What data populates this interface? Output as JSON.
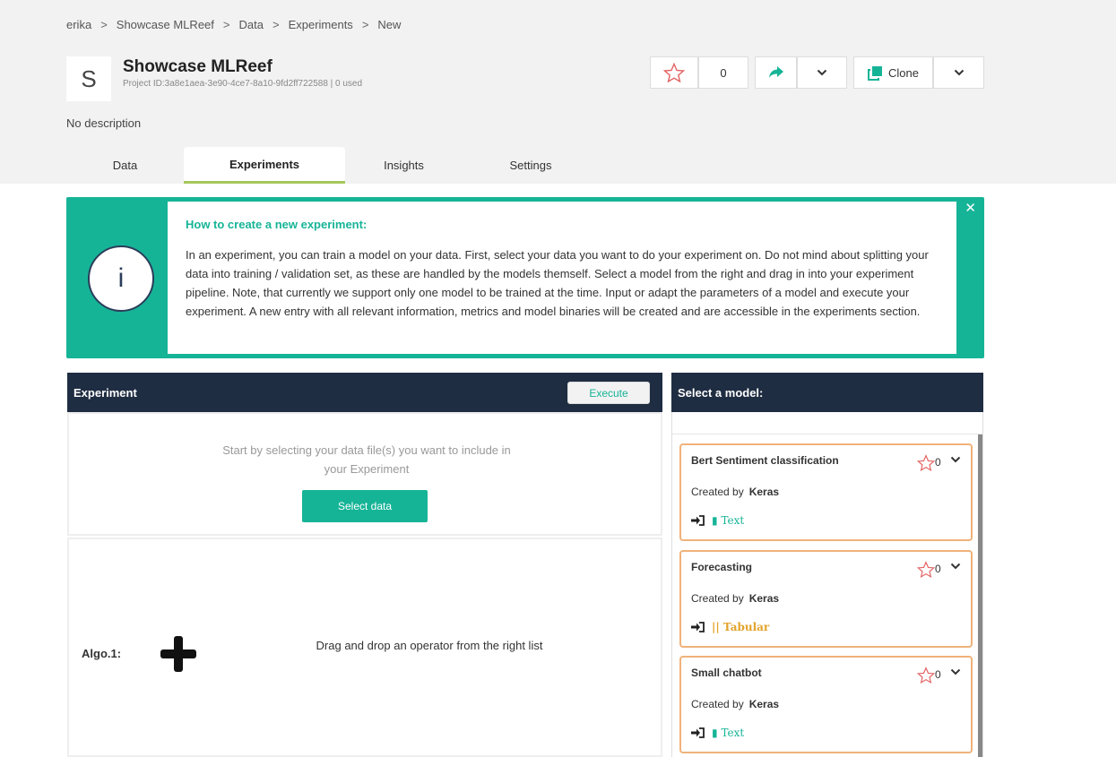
{
  "breadcrumbs": [
    "erika",
    "Showcase MLReef",
    "Data",
    "Experiments",
    "New"
  ],
  "breadcrumb_separator": ">",
  "project": {
    "avatar_letter": "S",
    "title": "Showcase MLReef",
    "id_line": "Project ID:3a8e1aea-3e90-4ce7-8a10-9fd2ff722588 | 0 used",
    "description": "No description"
  },
  "actions": {
    "star_count": "0",
    "clone_label": "Clone"
  },
  "tabs": [
    {
      "label": "Data"
    },
    {
      "label": "Experiments"
    },
    {
      "label": "Insights"
    },
    {
      "label": "Settings"
    }
  ],
  "info": {
    "title": "How to create a new experiment:",
    "body": "In an experiment, you can train a model on your data. First, select your data you want to do your experiment on. Do not mind about splitting your data into training / validation set, as these are handled by the models themself. Select a model from the right and drag in into your experiment pipeline. Note, that currently we support only one model to be trained at the time. Input or adapt the parameters of a model and execute your experiment. A new entry with all relevant information, metrics and model binaries will be created and are accessible in the experiments section."
  },
  "experiment": {
    "header": "Experiment",
    "execute_label": "Execute",
    "data_hint": "Start by selecting your data file(s) you want to include in your Experiment",
    "select_data_label": "Select data",
    "algo_label": "Algo.1:",
    "dnd_hint": "Drag and drop an operator from the right list"
  },
  "models": {
    "header": "Select a model:",
    "created_by_label": "Created by",
    "items": [
      {
        "name": "Bert Sentiment classification",
        "stars": "0",
        "author": "Keras",
        "tag": "Text"
      },
      {
        "name": "Forecasting",
        "stars": "0",
        "author": "Keras",
        "tag": "Tabular"
      },
      {
        "name": "Small chatbot",
        "stars": "0",
        "author": "Keras",
        "tag": "Text"
      }
    ]
  },
  "colors": {
    "accent": "#16b497",
    "dark_header": "#1f2d42",
    "card_border": "#f0b27a",
    "tab_underline": "#a6c75a",
    "star": "#e36262"
  }
}
